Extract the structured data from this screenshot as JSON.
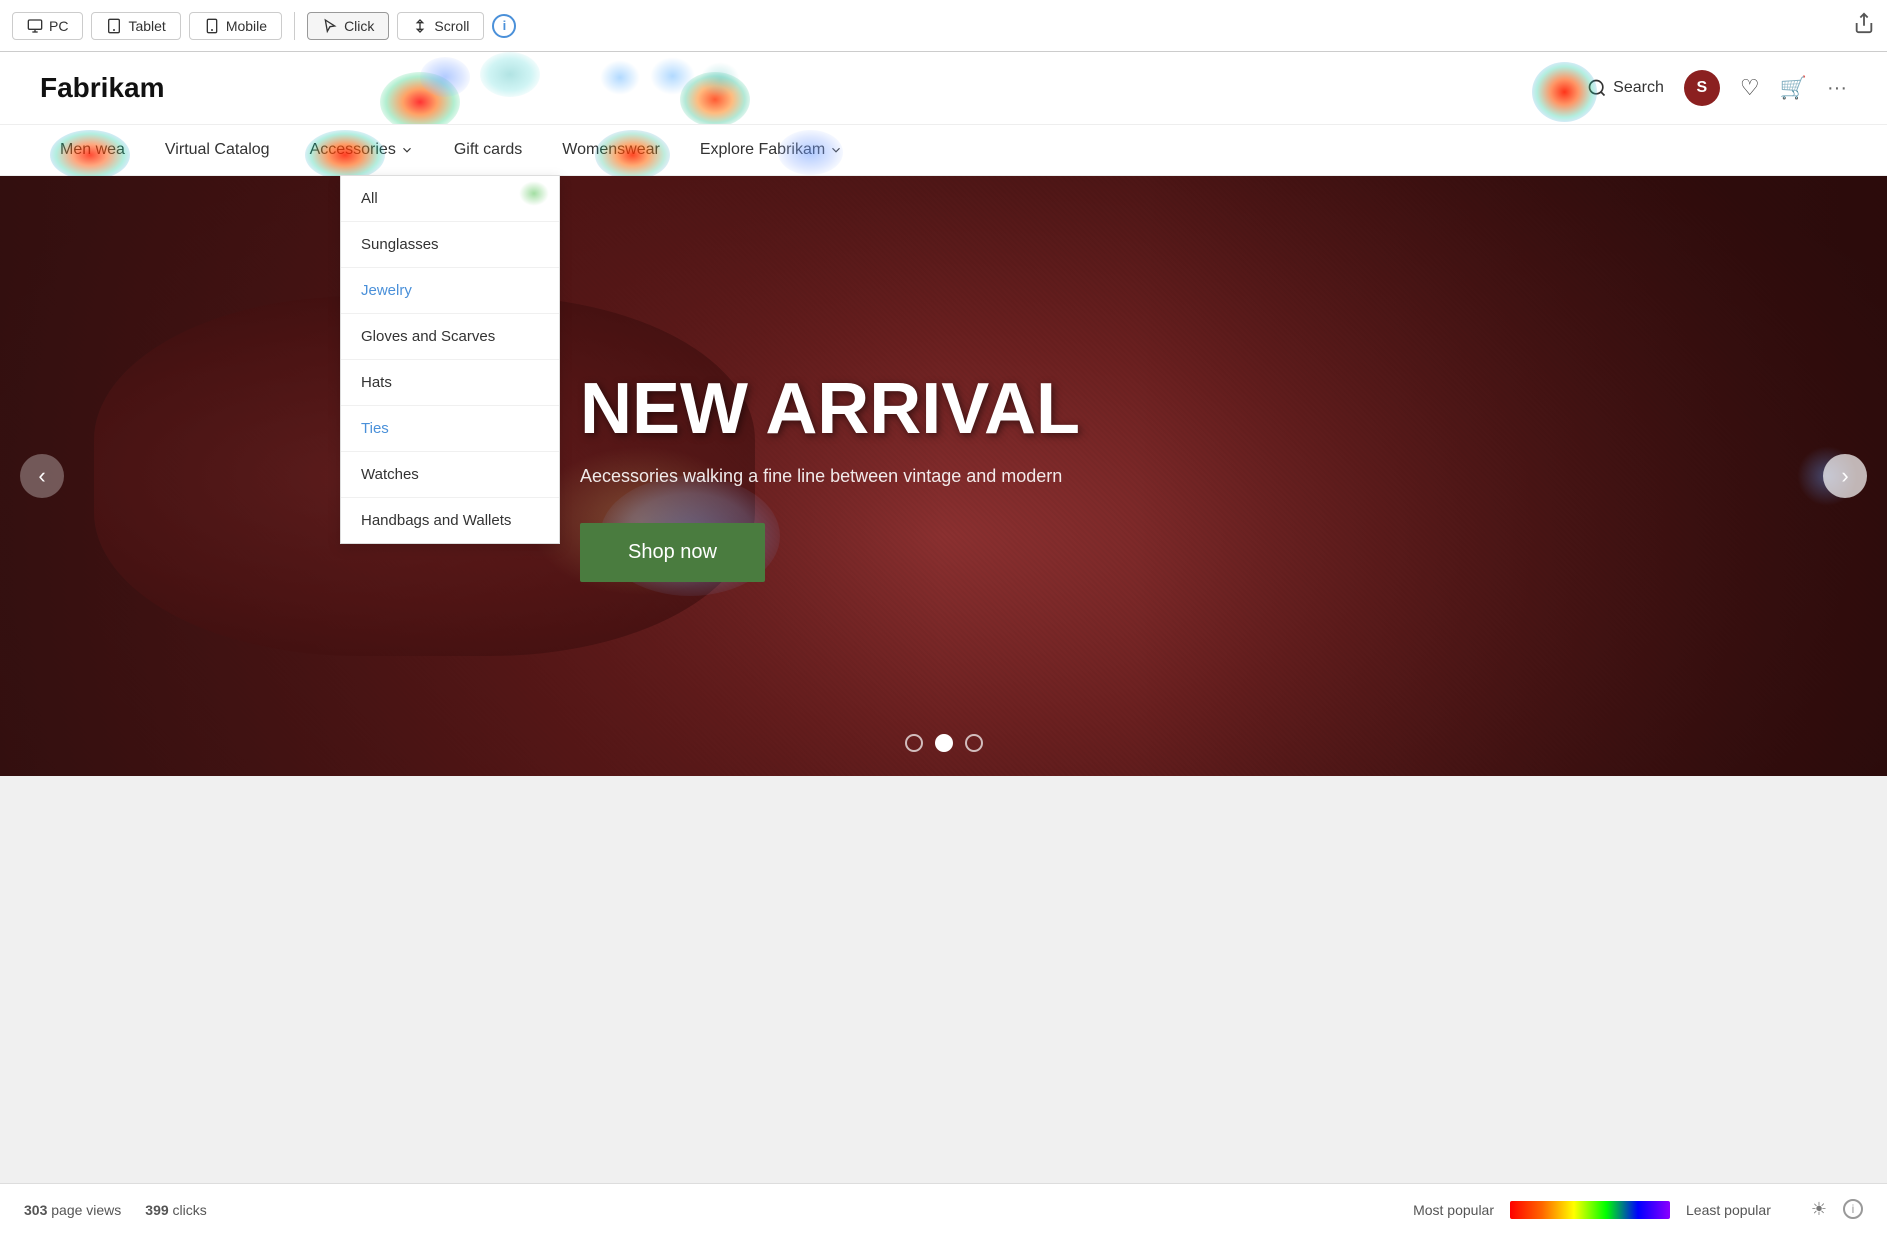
{
  "toolbar": {
    "pc_label": "PC",
    "tablet_label": "Tablet",
    "mobile_label": "Mobile",
    "click_label": "Click",
    "scroll_label": "Scroll",
    "info_symbol": "i",
    "share_symbol": "⎋"
  },
  "header": {
    "logo": "Fabrikam",
    "search_label": "Search",
    "cart_icon": "🛒",
    "wishlist_icon": "♡",
    "account_icon": "S"
  },
  "nav": {
    "items": [
      {
        "label": "Men wea",
        "has_dropdown": false
      },
      {
        "label": "Virtual Catalog",
        "has_dropdown": false
      },
      {
        "label": "Accessories",
        "has_dropdown": true
      },
      {
        "label": "Gift cards",
        "has_dropdown": false
      },
      {
        "label": "Womenswear",
        "has_dropdown": false
      },
      {
        "label": "Explore Fabrikam",
        "has_dropdown": true
      }
    ],
    "dropdown_items": [
      {
        "label": "All",
        "highlighted": false
      },
      {
        "label": "Sunglasses",
        "highlighted": false
      },
      {
        "label": "Jewelry",
        "highlighted": true
      },
      {
        "label": "Gloves and Scarves",
        "highlighted": false
      },
      {
        "label": "Hats",
        "highlighted": false
      },
      {
        "label": "Ties",
        "highlighted": true
      },
      {
        "label": "Watches",
        "highlighted": false
      },
      {
        "label": "Handbags and Wallets",
        "highlighted": false
      }
    ]
  },
  "hero": {
    "title": "EW ARRIVAL",
    "title_prefix": "N",
    "subtitle": "ecessories walking a fine line between vintage and modern",
    "cta_label": "Shop now",
    "dots": [
      {
        "active": false
      },
      {
        "active": true
      },
      {
        "active": false
      }
    ]
  },
  "status_bar": {
    "page_views_count": "303",
    "page_views_label": "page views",
    "clicks_count": "399",
    "clicks_label": "clicks",
    "legend_most": "Most popular",
    "legend_least": "Least popular"
  }
}
